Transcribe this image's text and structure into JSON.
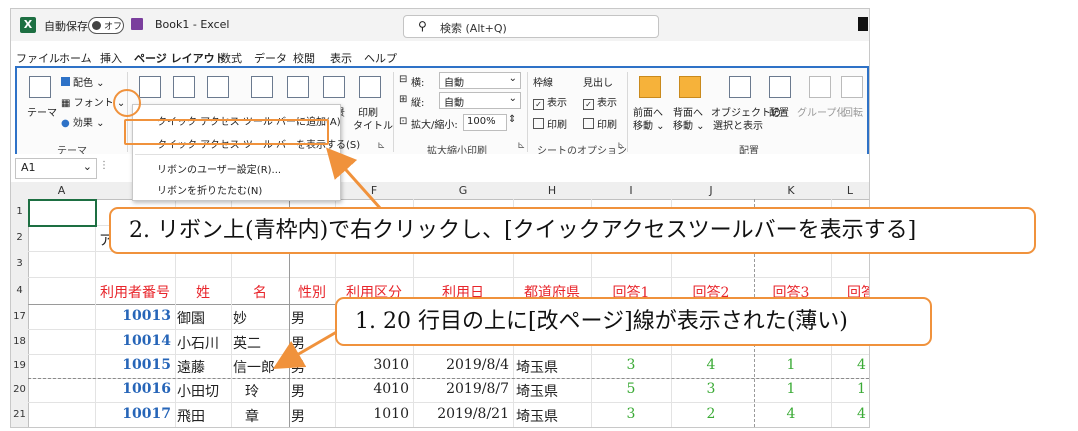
{
  "titlebar": {
    "autosave_label": "自動保存",
    "autosave_state": "オフ",
    "book_title": "Book1 - Excel",
    "search_placeholder": "検索 (Alt+Q)"
  },
  "menu": [
    "ファイル",
    "ホーム",
    "挿入",
    "ページ レイアウト",
    "数式",
    "データ",
    "校閲",
    "表示",
    "ヘルプ"
  ],
  "ribbon": {
    "theme": "テーマ",
    "colors": "配色",
    "fonts": "フォント",
    "effects": "効果",
    "theme_group": "テーマ",
    "background": "景",
    "print_titles_1": "印刷",
    "print_titles_2": "タイトル",
    "width_label": "横:",
    "width_value": "自動",
    "height_label": "縦:",
    "height_value": "自動",
    "scale_label": "拡大/縮小:",
    "scale_value": "100%",
    "scale_group": "拡大縮小印刷",
    "gridlines": "枠線",
    "headings": "見出し",
    "view1": "表示",
    "view2": "表示",
    "print1": "印刷",
    "print2": "印刷",
    "sheet_options_group": "シートのオプション",
    "bring_forward_1": "前面へ",
    "bring_forward_2": "移動",
    "send_backward_1": "背面へ",
    "send_backward_2": "移動",
    "selection_pane_1": "オブジェクトの",
    "selection_pane_2": "選択と表示",
    "align": "配置",
    "group": "グループ化",
    "rotate": "回転",
    "arrange_group": "配置"
  },
  "context_menu": {
    "item1": "クイック アクセス ツール バーに追加(A)",
    "item2": "クイック アクセス ツール バーを表示する(S)",
    "item3": "リボンのユーザー設定(R)...",
    "item4": "リボンを折りたたむ(N)"
  },
  "namebox": "A1",
  "columns": [
    "A",
    "B",
    "C",
    "D",
    "E",
    "F",
    "G",
    "H",
    "I",
    "J",
    "K",
    "L"
  ],
  "row_numbers": [
    "1",
    "2",
    "3",
    "4",
    "17",
    "18",
    "19",
    "20",
    "21"
  ],
  "cells": {
    "b2": "ア",
    "headers": [
      "利用者番号",
      "姓",
      "名",
      "性別",
      "利用区分",
      "利用日",
      "都道府県",
      "回答1",
      "回答2",
      "回答3",
      "回答"
    ],
    "rows": [
      {
        "id": "10013",
        "sei": "御園",
        "mei": "妙",
        "sex": "男",
        "kubun": "",
        "date": "",
        "pref": "",
        "a1": "",
        "a2": "",
        "a3": "",
        "a4": ""
      },
      {
        "id": "10014",
        "sei": "小石川",
        "mei": "英二",
        "sex": "男",
        "kubun": "",
        "date": "",
        "pref": "",
        "a1": "",
        "a2": "",
        "a3": "",
        "a4": ""
      },
      {
        "id": "10015",
        "sei": "遠藤",
        "mei": "信一郎",
        "sex": "男",
        "kubun": "3010",
        "date": "2019/8/4",
        "pref": "埼玉県",
        "a1": "3",
        "a2": "4",
        "a3": "1",
        "a4": "4"
      },
      {
        "id": "10016",
        "sei": "小田切",
        "mei": "玲",
        "sex": "男",
        "kubun": "4010",
        "date": "2019/8/7",
        "pref": "埼玉県",
        "a1": "5",
        "a2": "3",
        "a3": "1",
        "a4": "1"
      },
      {
        "id": "10017",
        "sei": "飛田",
        "mei": "章",
        "sex": "男",
        "kubun": "1010",
        "date": "2019/8/21",
        "pref": "埼玉県",
        "a1": "3",
        "a2": "2",
        "a3": "4",
        "a4": "4"
      }
    ]
  },
  "callouts": {
    "c2": "2. リボン上(青枠内)で右クリックし、[クイックアクセスツールバーを表示する]",
    "c1": "1. 20 行目の上に[改ページ]線が表示された(薄い)"
  },
  "colors": {
    "accent": "#f0923c",
    "ribbon_border": "#2e72c7",
    "header_red": "#e8252b",
    "id_blue": "#2665b8",
    "answer_green": "#3aaa35"
  }
}
